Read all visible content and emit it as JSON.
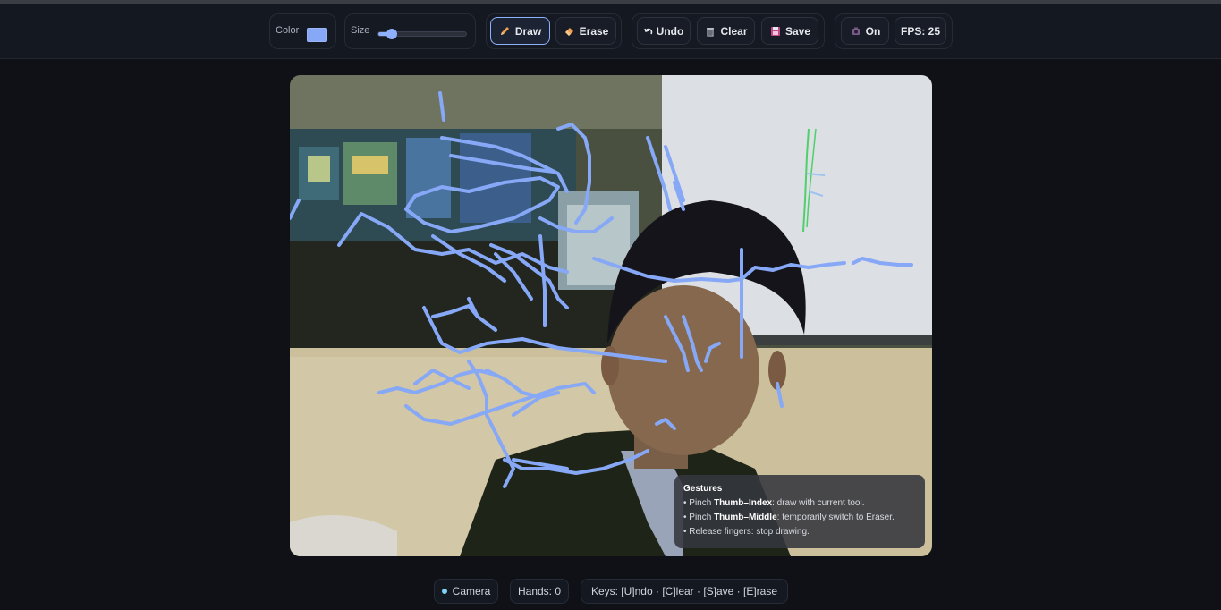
{
  "toolbar": {
    "color_label": "Color",
    "color_value": "#86a8f7",
    "size_label": "Size",
    "size_value_fraction": 0.15,
    "draw_label": "Draw",
    "erase_label": "Erase",
    "undo_label": "Undo",
    "clear_label": "Clear",
    "save_label": "Save",
    "toggle_label": "On",
    "fps_label": "FPS: 25"
  },
  "gestures": {
    "title": "Gestures",
    "line1_prefix": "• Pinch ",
    "line1_bold": "Thumb–Index",
    "line1_suffix": ": draw with current tool.",
    "line2_prefix": "• Pinch ",
    "line2_bold": "Thumb–Middle",
    "line2_suffix": ": temporarily switch to Eraser.",
    "line3": "• Release fingers: stop drawing."
  },
  "footer": {
    "camera_label": "Camera",
    "hands_label": "Hands: 0",
    "keys_label": "Keys: [U]ndo · [C]lear · [S]ave · [E]rase"
  },
  "colors": {
    "stroke": "#86a8f7",
    "accent": "#8fb0ff",
    "camera_dot": "#7fd2f5"
  },
  "icons": {
    "draw": "pencil-icon",
    "erase": "eraser-icon",
    "undo": "undo-arrow-icon",
    "clear": "trash-icon",
    "save": "floppy-disk-icon",
    "toggle": "camera-icon"
  }
}
